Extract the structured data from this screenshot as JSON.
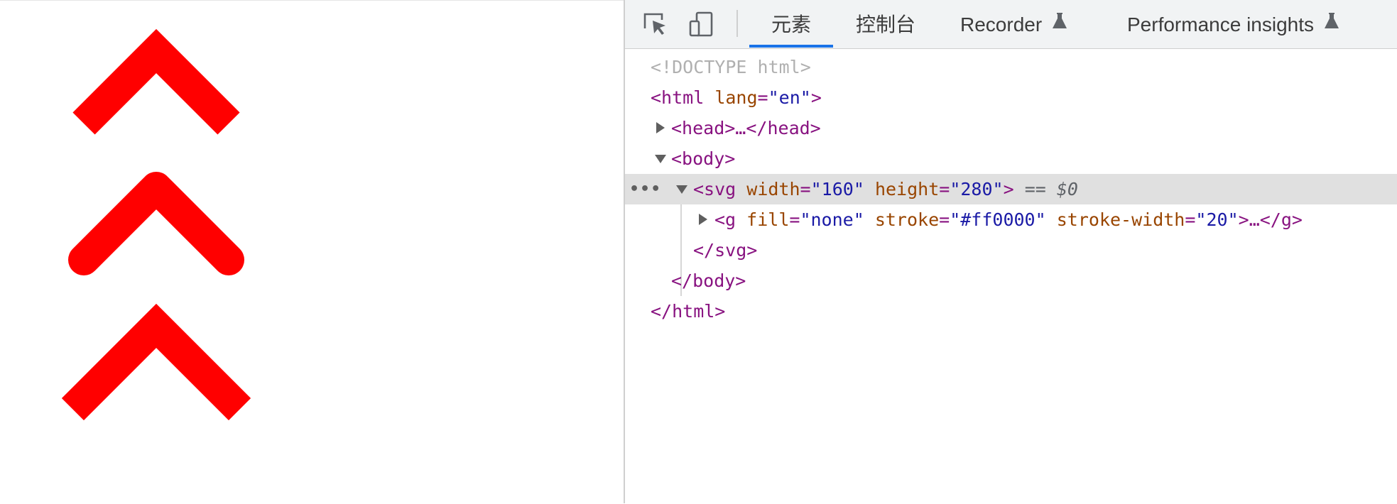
{
  "page": {
    "arrow_color": "#ff0000",
    "arrows": [
      {
        "style": "miter",
        "linecap": "butt",
        "linejoin": "miter"
      },
      {
        "style": "round",
        "linecap": "round",
        "linejoin": "round"
      },
      {
        "style": "square",
        "linecap": "square",
        "linejoin": "miter"
      }
    ]
  },
  "devtools": {
    "toolbar": {
      "inspect_icon": "inspect-cursor-icon",
      "device_icon": "device-toggle-icon",
      "tabs": [
        {
          "label": "元素",
          "active": true
        },
        {
          "label": "控制台",
          "active": false
        },
        {
          "label": "Recorder",
          "active": false,
          "icon": "flask-icon"
        },
        {
          "label": "Performance insights",
          "active": false,
          "icon": "flask-icon"
        }
      ]
    },
    "dom": {
      "doctype": "<!DOCTYPE html>",
      "html_open": "<html",
      "html_attr_name": "lang",
      "html_attr_value": "\"en\"",
      "gt": ">",
      "head": "<head>…</head>",
      "body_open": "<body>",
      "svg_open": "<svg",
      "svg_width_name": "width",
      "svg_width_value": "\"160\"",
      "svg_height_name": "height",
      "svg_height_value": "\"280\"",
      "selected_marker": "== $0",
      "g_open": "<g",
      "g_fill_name": "fill",
      "g_fill_value": "\"none\"",
      "g_stroke_name": "stroke",
      "g_stroke_value": "\"#ff0000\"",
      "g_sw_name": "stroke-width",
      "g_sw_value": "\"20\"",
      "g_close": ">…</g>",
      "svg_close": "</svg>",
      "body_close": "</body>",
      "html_close": "</html>",
      "dots": "•••",
      "eq": "="
    }
  }
}
